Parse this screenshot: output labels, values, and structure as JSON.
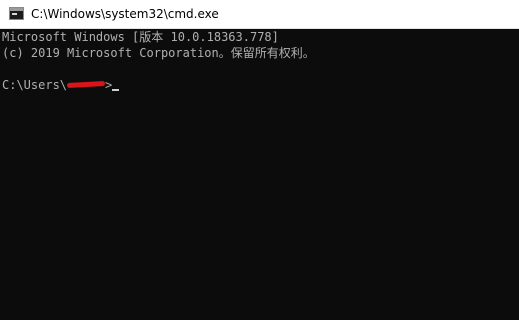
{
  "window": {
    "title": "C:\\Windows\\system32\\cmd.exe",
    "icon": "cmd-app-icon"
  },
  "console": {
    "lines": [
      "Microsoft Windows [版本 10.0.18363.778]",
      "(c) 2019 Microsoft Corporation。保留所有权利。"
    ],
    "prompt_prefix": "C:\\Users\\",
    "prompt_suffix": ">",
    "redaction_color": "#d8151b"
  },
  "colors": {
    "background": "#0c0c0c",
    "text": "#b0b0b0",
    "titlebar": "#ffffff"
  }
}
